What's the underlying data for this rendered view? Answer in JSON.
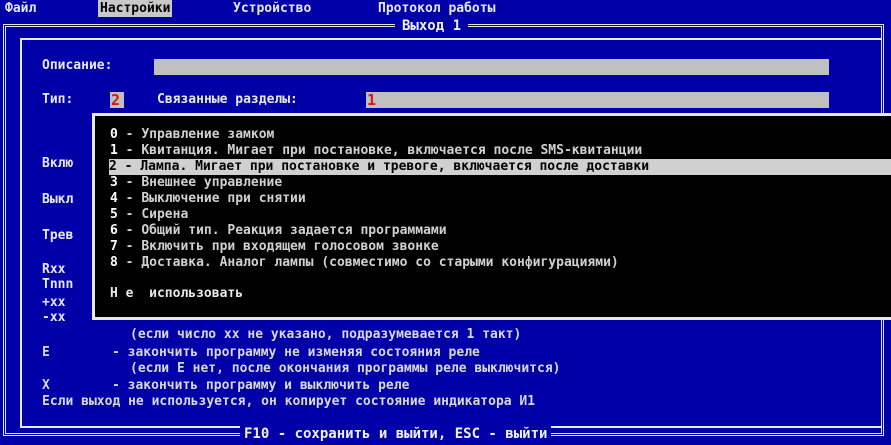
{
  "menu": {
    "file": "Файл",
    "settings": "Настройки",
    "device": "Устройство",
    "protocol": "Протокол работы"
  },
  "window_title": "Выход 1",
  "form": {
    "description_label": "Описание:",
    "type_label": "Тип:",
    "type_value": "2",
    "linked_label": "Связанные разделы:",
    "linked_value": "1",
    "side_labels": [
      "Вклю",
      "Выкл",
      "Трев",
      "Rxx",
      "Tnnn",
      "+xx",
      "-xx"
    ]
  },
  "options": [
    {
      "num": "0",
      "text": "Управление замком"
    },
    {
      "num": "1",
      "text": "Квитанция. Мигает при постановке, включается после SMS-квитанции"
    },
    {
      "num": "2",
      "text": "Лампа. Мигает при постановке и тревоге, включается после доставки"
    },
    {
      "num": "3",
      "text": "Внешнее управление"
    },
    {
      "num": "4",
      "text": "Выключение при снятии"
    },
    {
      "num": "5",
      "text": "Сирена"
    },
    {
      "num": "6",
      "text": "Общий тип. Реакция задается программами"
    },
    {
      "num": "7",
      "text": "Включить при входящем голосовом звонке"
    },
    {
      "num": "8",
      "text": "Доставка. Аналог лампы (совместимо со старыми конфигурациями)"
    }
  ],
  "selected_option": "2",
  "not_used": "Н е  использовать",
  "help": {
    "line1": "(если число xx не указано, подразумевается 1 такт)",
    "e_key": "E",
    "line2": "- закончить программу не изменяя состояния реле",
    "line3": "(если E нет, после окончания программы реле выключится)",
    "x_key": "X",
    "line4": "- закончить программу и выключить реле",
    "line5": "Если выход не используется, он копирует состояние индикатора И1"
  },
  "footer": "F10 - сохранить и выйти, ESC - выйти",
  "colors": {
    "background": "#0000a8",
    "popup": "#000000",
    "field": "#c0c0c0",
    "accent": "#d01818"
  }
}
